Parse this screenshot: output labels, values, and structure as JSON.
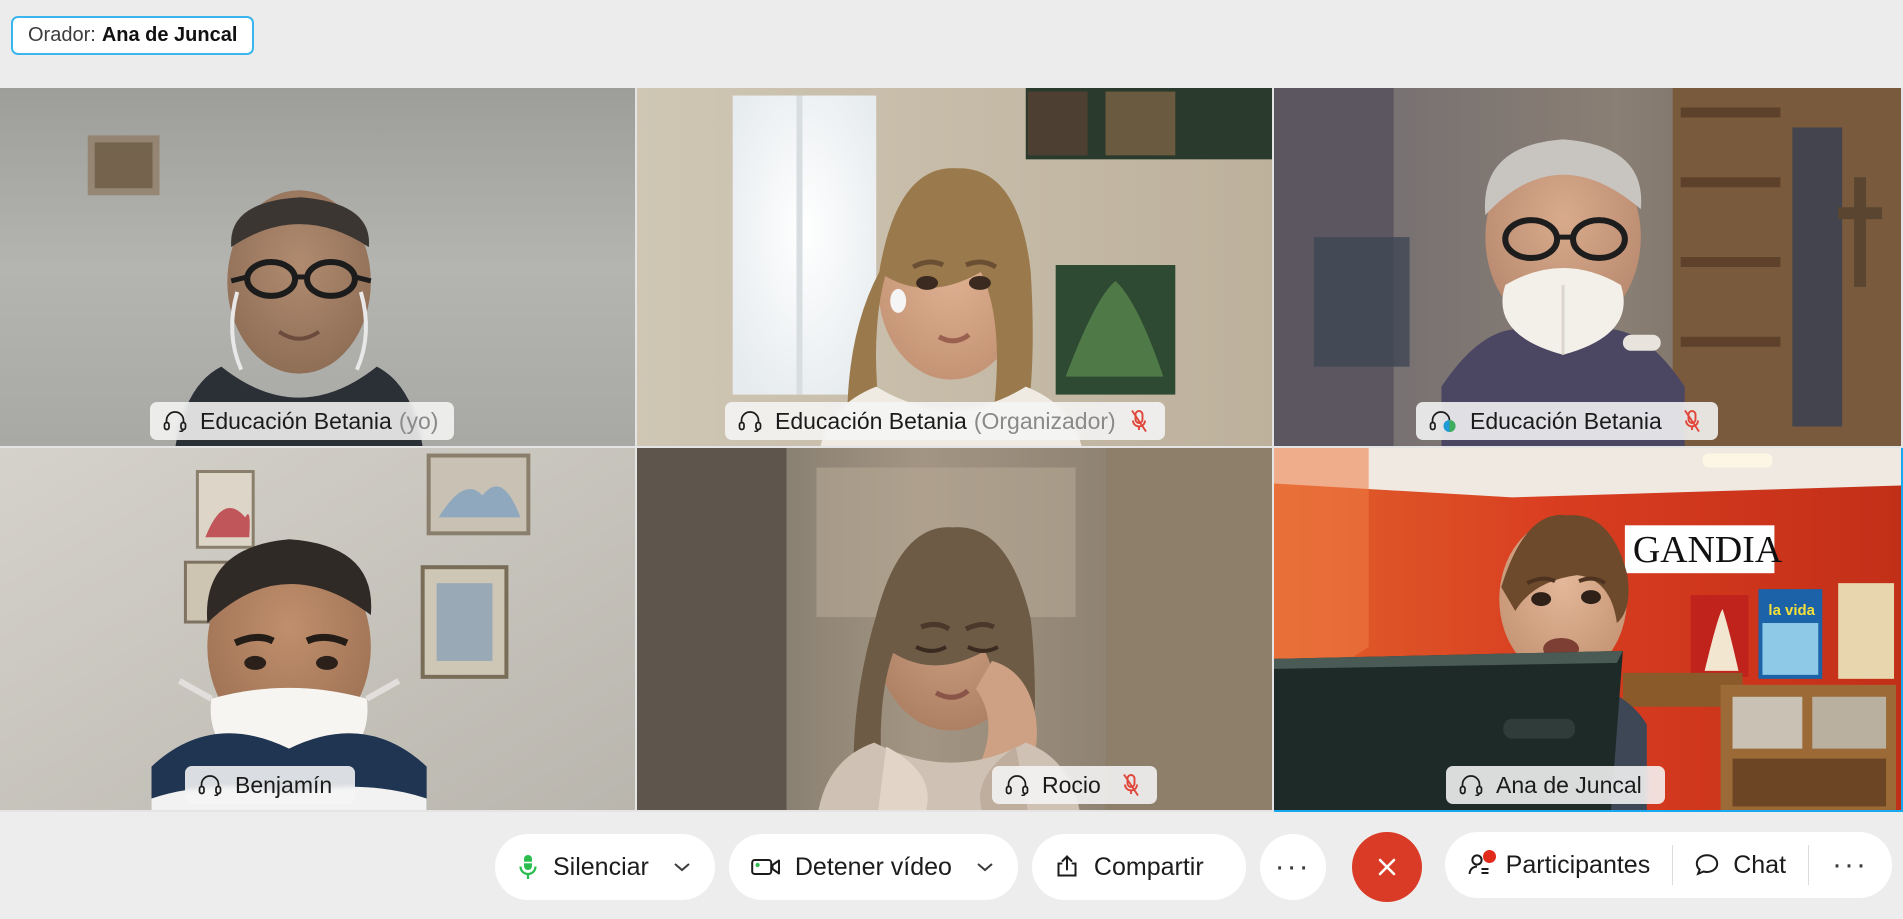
{
  "speaker_banner": {
    "label": "Orador:",
    "name": "Ana de Juncal",
    "border_color": "#3ab6ef"
  },
  "tiles": [
    {
      "name": "Educación Betania",
      "suffix": "(yo)",
      "icon": "headset-icon",
      "muted": false,
      "active_speaker": false
    },
    {
      "name": "Educación Betania",
      "suffix": "(Organizador)",
      "icon": "headset-icon",
      "muted": true,
      "active_speaker": false
    },
    {
      "name": "Educación Betania",
      "suffix": "",
      "icon": "headset-status-icon",
      "muted": true,
      "active_speaker": false
    },
    {
      "name": "Benjamín",
      "suffix": "",
      "icon": "headset-icon",
      "muted": false,
      "active_speaker": false
    },
    {
      "name": "Rocio",
      "suffix": "",
      "icon": "headset-icon",
      "muted": true,
      "active_speaker": false
    },
    {
      "name": "Ana de Juncal",
      "suffix": "",
      "icon": "headset-icon",
      "muted": false,
      "active_speaker": true
    }
  ],
  "toolbar": {
    "mute_label": "Silenciar",
    "video_label": "Detener vídeo",
    "share_label": "Compartir",
    "more_label": "···",
    "participants_label": "Participantes",
    "chat_label": "Chat",
    "right_more_label": "···",
    "leave_icon": "close-icon",
    "mic_color": "#2bbd4e",
    "camera_dot_color": "#2bbd4e",
    "leave_color": "#d93b26",
    "badge_color": "#e02b1d"
  }
}
